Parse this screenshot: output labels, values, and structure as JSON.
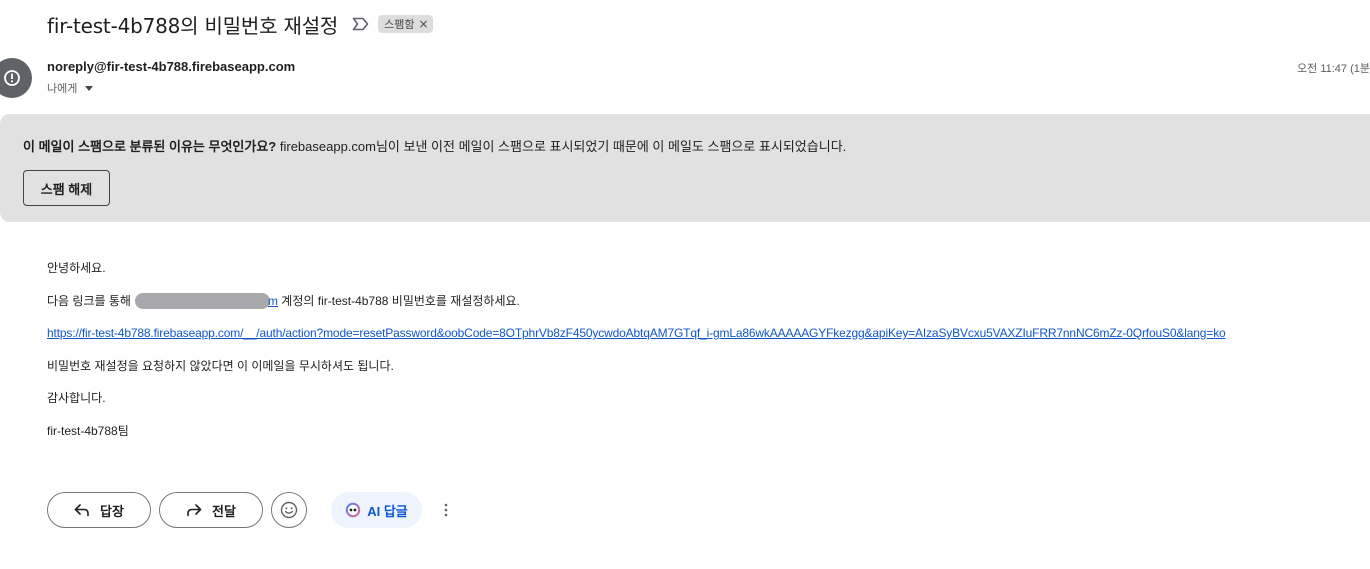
{
  "email": {
    "subject": "fir-test-4b788의 비밀번호 재설정",
    "label": "스팸함",
    "label_remove": "×",
    "sender": "noreply@fir-test-4b788.firebaseapp.com",
    "recipient": "나에게",
    "timestamp": "오전 11:47 (1분"
  },
  "spam_banner": {
    "question": "이 메일이 스팸으로 분류된 이유는 무엇인가요?",
    "explanation": " firebaseapp.com님이 보낸 이전 메일이 스팸으로 표시되었기 때문에 이 메일도 스팸으로 표시되었습니다.",
    "button_label": "스팸 해제"
  },
  "body": {
    "greeting": "안녕하세요.",
    "line2_prefix": "다음 링크를 통해",
    "line2_email_tail": "m",
    "line2_suffix": " 계정의 fir-test-4b788 비밀번호를 재설정하세요.",
    "reset_link": "https://fir-test-4b788.firebaseapp.com/__/auth/action?mode=resetPassword&oobCode=8OTphrVb8zF450ycwdoAbtqAM7GTqf_i-gmLa86wkAAAAAGYFkezgg&apiKey=AIzaSyBVcxu5VAXZIuFRR7nnNC6mZz-0QrfouS0&lang=ko",
    "ignore_line": "비밀번호 재설정을 요청하지 않았다면 이 이메일을 무시하셔도 됩니다.",
    "thanks": "감사합니다.",
    "signature": "fir-test-4b788팀"
  },
  "actions": {
    "reply_label": "답장",
    "forward_label": "전달",
    "ai_reply_label": "AI 답글"
  },
  "icons": {
    "important": "important-marker-icon",
    "avatar": "alert-avatar-icon",
    "reply": "reply-arrow-icon",
    "forward": "forward-arrow-icon",
    "emoji": "emoji-smile-icon",
    "ai": "ai-sparkle-icon",
    "more": "more-vertical-icon"
  },
  "colors": {
    "banner_bg": "#e1e1e1",
    "link": "#1155cc",
    "ai_accent": "#0b57d0",
    "avatar_bg": "#5f6368"
  }
}
